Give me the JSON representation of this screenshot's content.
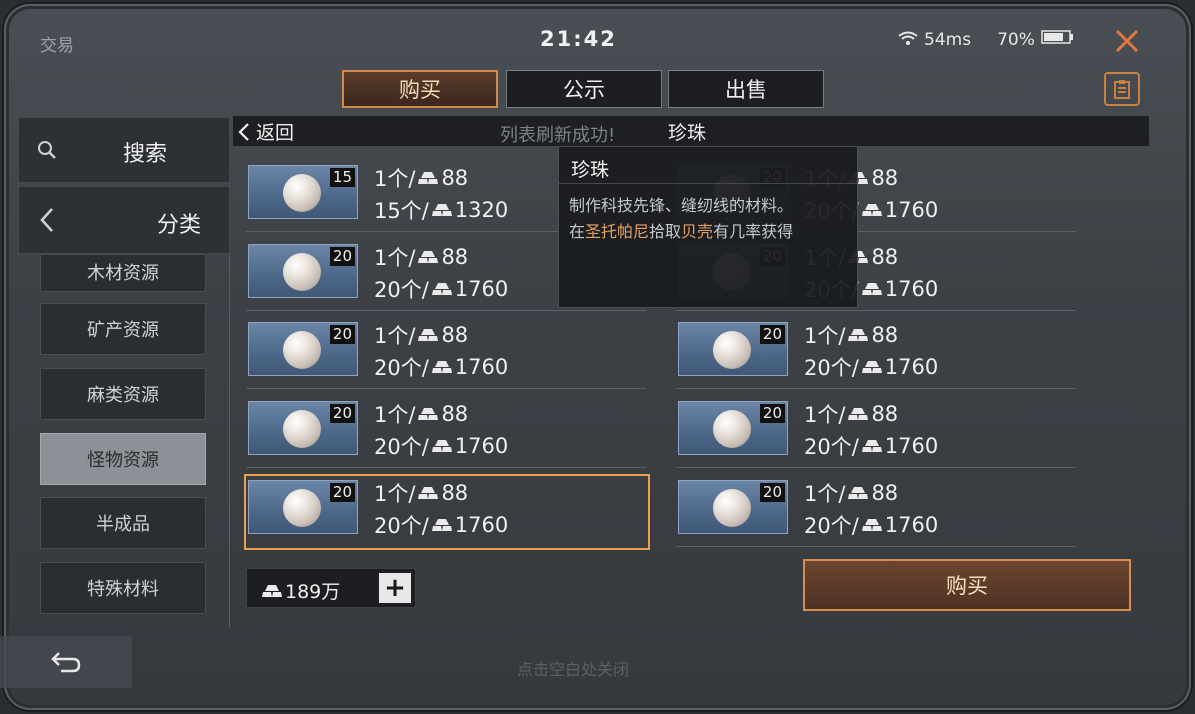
{
  "topbar": {
    "title": "交易",
    "time": "21:42",
    "ping": "54ms",
    "battery": "70%"
  },
  "tabs": [
    {
      "label": "购买",
      "active": true
    },
    {
      "label": "公示",
      "active": false
    },
    {
      "label": "出售",
      "active": false
    }
  ],
  "sidebar": {
    "search_label": "搜索",
    "category_label": "分类",
    "items": [
      {
        "label": "木材资源",
        "active": false
      },
      {
        "label": "矿产资源",
        "active": false
      },
      {
        "label": "麻类资源",
        "active": false
      },
      {
        "label": "怪物资源",
        "active": true
      },
      {
        "label": "半成品",
        "active": false
      },
      {
        "label": "特殊材料",
        "active": false
      }
    ]
  },
  "header": {
    "back_label": "返回",
    "toast": "列表刷新成功!",
    "title": "珍珠"
  },
  "listings": [
    {
      "qty": "15",
      "unit_price": "1个/",
      "unit_value": "88",
      "total_prefix": "15个/",
      "total_value": "1320"
    },
    {
      "qty": "20",
      "unit_price": "1个/",
      "unit_value": "88",
      "total_prefix": "20个/",
      "total_value": "1760"
    },
    {
      "qty": "20",
      "unit_price": "1个/",
      "unit_value": "88",
      "total_prefix": "20个/",
      "total_value": "1760"
    },
    {
      "qty": "20",
      "unit_price": "1个/",
      "unit_value": "88",
      "total_prefix": "20个/",
      "total_value": "1760"
    },
    {
      "qty": "20",
      "unit_price": "1个/",
      "unit_value": "88",
      "total_prefix": "20个/",
      "total_value": "1760"
    },
    {
      "qty": "20",
      "unit_price": "1个/",
      "unit_value": "88",
      "total_prefix": "20个/",
      "total_value": "1760"
    },
    {
      "qty": "20",
      "unit_price": "1个/",
      "unit_value": "88",
      "total_prefix": "20个/",
      "total_value": "1760"
    },
    {
      "qty": "20",
      "unit_price": "1个/",
      "unit_value": "88",
      "total_prefix": "20个/",
      "total_value": "1760"
    },
    {
      "qty": "20",
      "unit_price": "1个/",
      "unit_value": "88",
      "total_prefix": "20个/",
      "total_value": "1760",
      "selected": true
    },
    {
      "qty": "20",
      "unit_price": "1个/",
      "unit_value": "88",
      "total_prefix": "20个/",
      "total_value": "1760"
    }
  ],
  "tooltip": {
    "title": "珍珠",
    "desc_line": "制作科技先锋、缝纫线的材料。",
    "source_prefix": "在",
    "source_place": "圣托帕尼",
    "source_mid": "拾取",
    "source_item": "贝壳",
    "source_suffix": "有几率获得"
  },
  "wallet": {
    "amount": "189万",
    "plus": "+"
  },
  "buy_button": "购买",
  "close_hint": "点击空白处关闭",
  "colors": {
    "accent": "#d68e4c",
    "highlight": "#e4a066",
    "selected_border": "#e9a04e"
  }
}
